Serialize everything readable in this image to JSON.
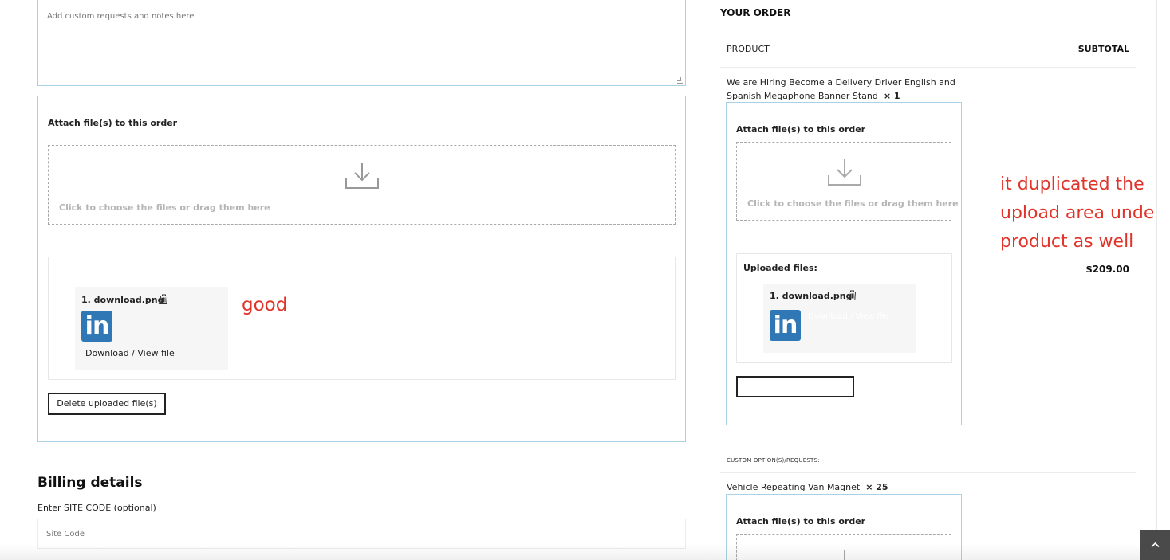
{
  "notes": {
    "placeholder": "Add custom requests and notes here"
  },
  "left_attach": {
    "title": "Attach file(s) to this order",
    "dropzone_text": "Click to choose the files or drag them here",
    "file_name": "1. download.png",
    "download_link": "Download / View file",
    "delete_button": "Delete uploaded file(s)"
  },
  "annotations": {
    "good": "good",
    "duplicate_line1": "it duplicated the",
    "duplicate_line2": "upload area unde",
    "duplicate_line3": "product as well",
    "color": "#e0342a"
  },
  "billing": {
    "title": "Billing details",
    "site_code_label": "Enter SITE CODE (optional)",
    "site_code_placeholder": "Site Code"
  },
  "order": {
    "title": "YOUR ORDER",
    "col_product": "PRODUCT",
    "col_subtotal": "SUBTOTAL",
    "product1_name": "We are Hiring Become a Delivery Driver English and Spanish Megaphone Banner Stand",
    "product1_qty": "× 1",
    "product1_price": "$209.00",
    "product1_attach_title": "Attach file(s) to this order",
    "product1_dropzone_text": "Click to choose the files or drag them here",
    "product1_uploaded_title": "Uploaded files:",
    "product1_file_name": "1. download.png",
    "product1_ghost_link": "Download / View file",
    "custom_options_label": "CUSTOM OPTION(S)/REQUESTS:",
    "product2_name": "Vehicle Repeating Van Magnet",
    "product2_qty": "× 25",
    "product2_attach_title": "Attach file(s) to this order"
  },
  "colors": {
    "panel_border": "#a9d3e3",
    "linkedin_blue": "#2f77b5",
    "scroll_button": "#4a4a4a"
  },
  "icons": [
    "download-tray-icon",
    "trash-icon",
    "linkedin-logo",
    "chevron-up-icon"
  ]
}
